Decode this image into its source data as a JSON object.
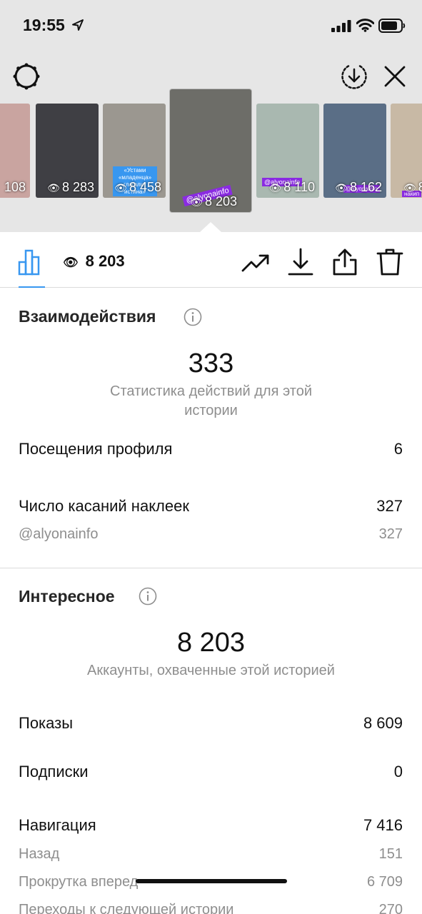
{
  "status": {
    "time": "19:55"
  },
  "icons": {
    "settings": "gear-icon",
    "download": "download-circle-icon",
    "close": "close-icon",
    "bars": "bar-chart-icon",
    "trend": "trend-icon",
    "save": "download-icon",
    "share": "share-icon",
    "delete": "trash-icon"
  },
  "thumbnails": [
    {
      "views": "108",
      "bg": "#c9a4a0"
    },
    {
      "views": "8 283",
      "bg": "#3f3f44"
    },
    {
      "views": "8 458",
      "bg": "#9b9790",
      "caption": "«Устами «младенца» глаголит истина»"
    },
    {
      "views": "8 203",
      "bg": "#6d6d68",
      "tag": "@alyonainfo"
    },
    {
      "views": "8 110",
      "bg": "#a9b8b0",
      "tag": "@alyonainfo"
    },
    {
      "views": "8 162",
      "bg": "#5a6e86",
      "tag": "@alyonainfo"
    },
    {
      "views": "8",
      "bg": "#c8b9a5",
      "tag": "накип"
    }
  ],
  "toolbar": {
    "views": "8 203",
    "accent": "#3897f0"
  },
  "interactions": {
    "title": "Взаимодействия",
    "total": "333",
    "caption": "Статистика действий для этой истории",
    "rows": [
      {
        "label": "Посещения профиля",
        "value": "6"
      },
      {
        "label": "Число касаний наклеек",
        "value": "327"
      }
    ],
    "sub_rows": [
      {
        "label": "@alyonainfo",
        "value": "327"
      }
    ]
  },
  "discovery": {
    "title": "Интересное",
    "total": "8 203",
    "caption": "Аккаунты, охваченные этой историей",
    "rows": [
      {
        "label": "Показы",
        "value": "8 609"
      },
      {
        "label": "Подписки",
        "value": "0"
      },
      {
        "label": "Навигация",
        "value": "7 416"
      }
    ],
    "sub_rows": [
      {
        "label": "Назад",
        "value": "151"
      },
      {
        "label": "Прокрутка вперед",
        "value": "6 709"
      },
      {
        "label": "Переходы к следующей истории",
        "value": "270"
      }
    ]
  }
}
